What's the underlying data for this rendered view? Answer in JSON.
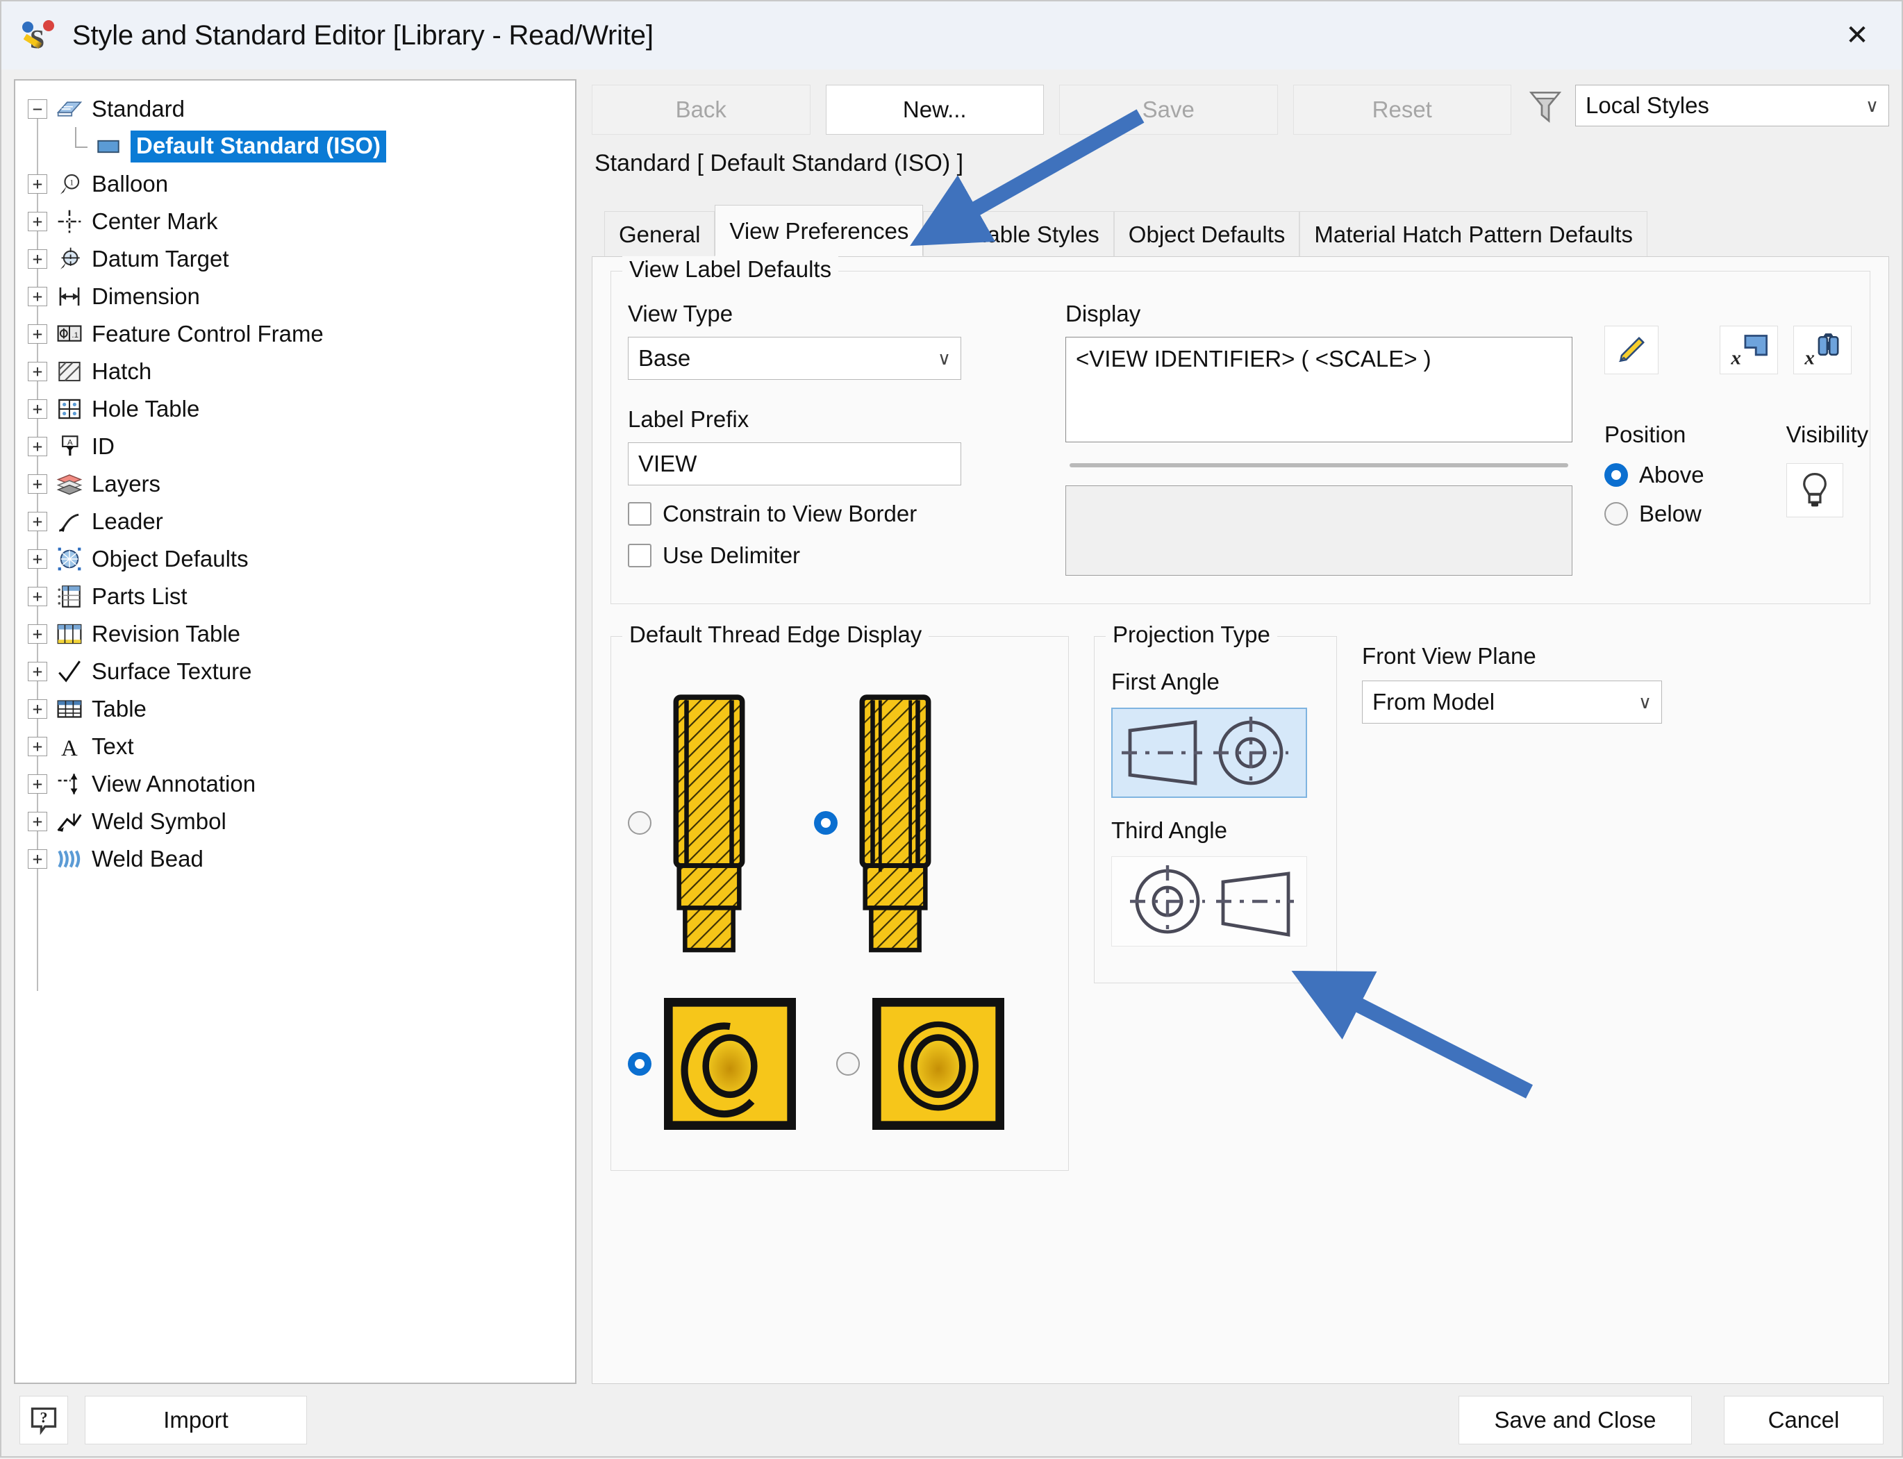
{
  "window": {
    "title": "Style and Standard Editor [Library - Read/Write]",
    "app_icon": "style-editor-icon",
    "close_label": "✕"
  },
  "tree": {
    "items": [
      {
        "label": "Standard",
        "icon": "book-icon",
        "expander": "minus",
        "level": 0,
        "selected": false
      },
      {
        "label": "Default Standard (ISO)",
        "icon": "style-swatch-icon",
        "expander": "none",
        "level": 1,
        "selected": true
      },
      {
        "label": "Balloon",
        "icon": "balloon-icon",
        "expander": "plus",
        "level": 0,
        "selected": false
      },
      {
        "label": "Center Mark",
        "icon": "center-mark-icon",
        "expander": "plus",
        "level": 0,
        "selected": false
      },
      {
        "label": "Datum Target",
        "icon": "datum-target-icon",
        "expander": "plus",
        "level": 0,
        "selected": false
      },
      {
        "label": "Dimension",
        "icon": "dimension-icon",
        "expander": "plus",
        "level": 0,
        "selected": false
      },
      {
        "label": "Feature Control Frame",
        "icon": "feature-control-frame-icon",
        "expander": "plus",
        "level": 0,
        "selected": false
      },
      {
        "label": "Hatch",
        "icon": "hatch-icon",
        "expander": "plus",
        "level": 0,
        "selected": false
      },
      {
        "label": "Hole Table",
        "icon": "hole-table-icon",
        "expander": "plus",
        "level": 0,
        "selected": false
      },
      {
        "label": "ID",
        "icon": "id-icon",
        "expander": "plus",
        "level": 0,
        "selected": false
      },
      {
        "label": "Layers",
        "icon": "layers-icon",
        "expander": "plus",
        "level": 0,
        "selected": false
      },
      {
        "label": "Leader",
        "icon": "leader-icon",
        "expander": "plus",
        "level": 0,
        "selected": false
      },
      {
        "label": "Object Defaults",
        "icon": "object-defaults-icon",
        "expander": "plus",
        "level": 0,
        "selected": false
      },
      {
        "label": "Parts List",
        "icon": "parts-list-icon",
        "expander": "plus",
        "level": 0,
        "selected": false
      },
      {
        "label": "Revision Table",
        "icon": "revision-table-icon",
        "expander": "plus",
        "level": 0,
        "selected": false
      },
      {
        "label": "Surface Texture",
        "icon": "surface-texture-icon",
        "expander": "plus",
        "level": 0,
        "selected": false
      },
      {
        "label": "Table",
        "icon": "table-icon",
        "expander": "plus",
        "level": 0,
        "selected": false
      },
      {
        "label": "Text",
        "icon": "text-icon",
        "expander": "plus",
        "level": 0,
        "selected": false
      },
      {
        "label": "View Annotation",
        "icon": "view-annotation-icon",
        "expander": "plus",
        "level": 0,
        "selected": false
      },
      {
        "label": "Weld Symbol",
        "icon": "weld-symbol-icon",
        "expander": "plus",
        "level": 0,
        "selected": false
      },
      {
        "label": "Weld Bead",
        "icon": "weld-bead-icon",
        "expander": "plus",
        "level": 0,
        "selected": false
      }
    ]
  },
  "toolbar": {
    "back_label": "Back",
    "new_label": "New...",
    "save_label": "Save",
    "reset_label": "Reset",
    "filter_icon": "funnel-icon",
    "style_filter_value": "Local Styles",
    "caret": "∨"
  },
  "standard_line": "Standard [ Default Standard (ISO) ]",
  "tabs": [
    {
      "label": "General",
      "active": false
    },
    {
      "label": "View Preferences",
      "active": true
    },
    {
      "label": "Available Styles",
      "active": false
    },
    {
      "label": "Object Defaults",
      "active": false
    },
    {
      "label": "Material Hatch Pattern Defaults",
      "active": false
    }
  ],
  "view_label_defaults": {
    "legend": "View Label Defaults",
    "view_type_label": "View Type",
    "view_type_value": "Base",
    "label_prefix_label": "Label Prefix",
    "label_prefix_value": "VIEW",
    "constrain_label": "Constrain to View Border",
    "constrain_checked": false,
    "delimiter_label": "Use Delimiter",
    "delimiter_checked": false,
    "display_label": "Display",
    "display_value": "<VIEW IDENTIFIER> ( <SCALE> )",
    "secondary_value": "",
    "edit_icon": "pencil-icon",
    "insert_symbol_icon": "x-insert-symbol-icon",
    "find_symbol_icon": "x-binoculars-icon",
    "position_label": "Position",
    "position_options": [
      {
        "label": "Above",
        "selected": true
      },
      {
        "label": "Below",
        "selected": false
      }
    ],
    "visibility_label": "Visibility",
    "visibility_icon": "lightbulb-icon"
  },
  "thread_edge": {
    "legend": "Default Thread Edge Display",
    "options": [
      {
        "name": "thread-full-line",
        "selected": false
      },
      {
        "name": "thread-partial-line",
        "selected": true
      },
      {
        "name": "thread-three-quarter-circle",
        "selected": true
      },
      {
        "name": "thread-full-circle",
        "selected": false
      }
    ]
  },
  "projection": {
    "legend": "Projection Type",
    "first_angle_label": "First Angle",
    "first_angle_selected": true,
    "third_angle_label": "Third Angle",
    "third_angle_selected": false
  },
  "front_view_plane": {
    "label": "Front View Plane",
    "value": "From Model",
    "caret": "∨"
  },
  "bottom": {
    "help_icon": "help-icon",
    "import_label": "Import",
    "save_close_label": "Save and Close",
    "cancel_label": "Cancel"
  },
  "annotations": {
    "arrow_color": "#3f72bd",
    "arrow_1_target": "view-preferences-tab",
    "arrow_2_target": "third-angle-projection-button"
  }
}
